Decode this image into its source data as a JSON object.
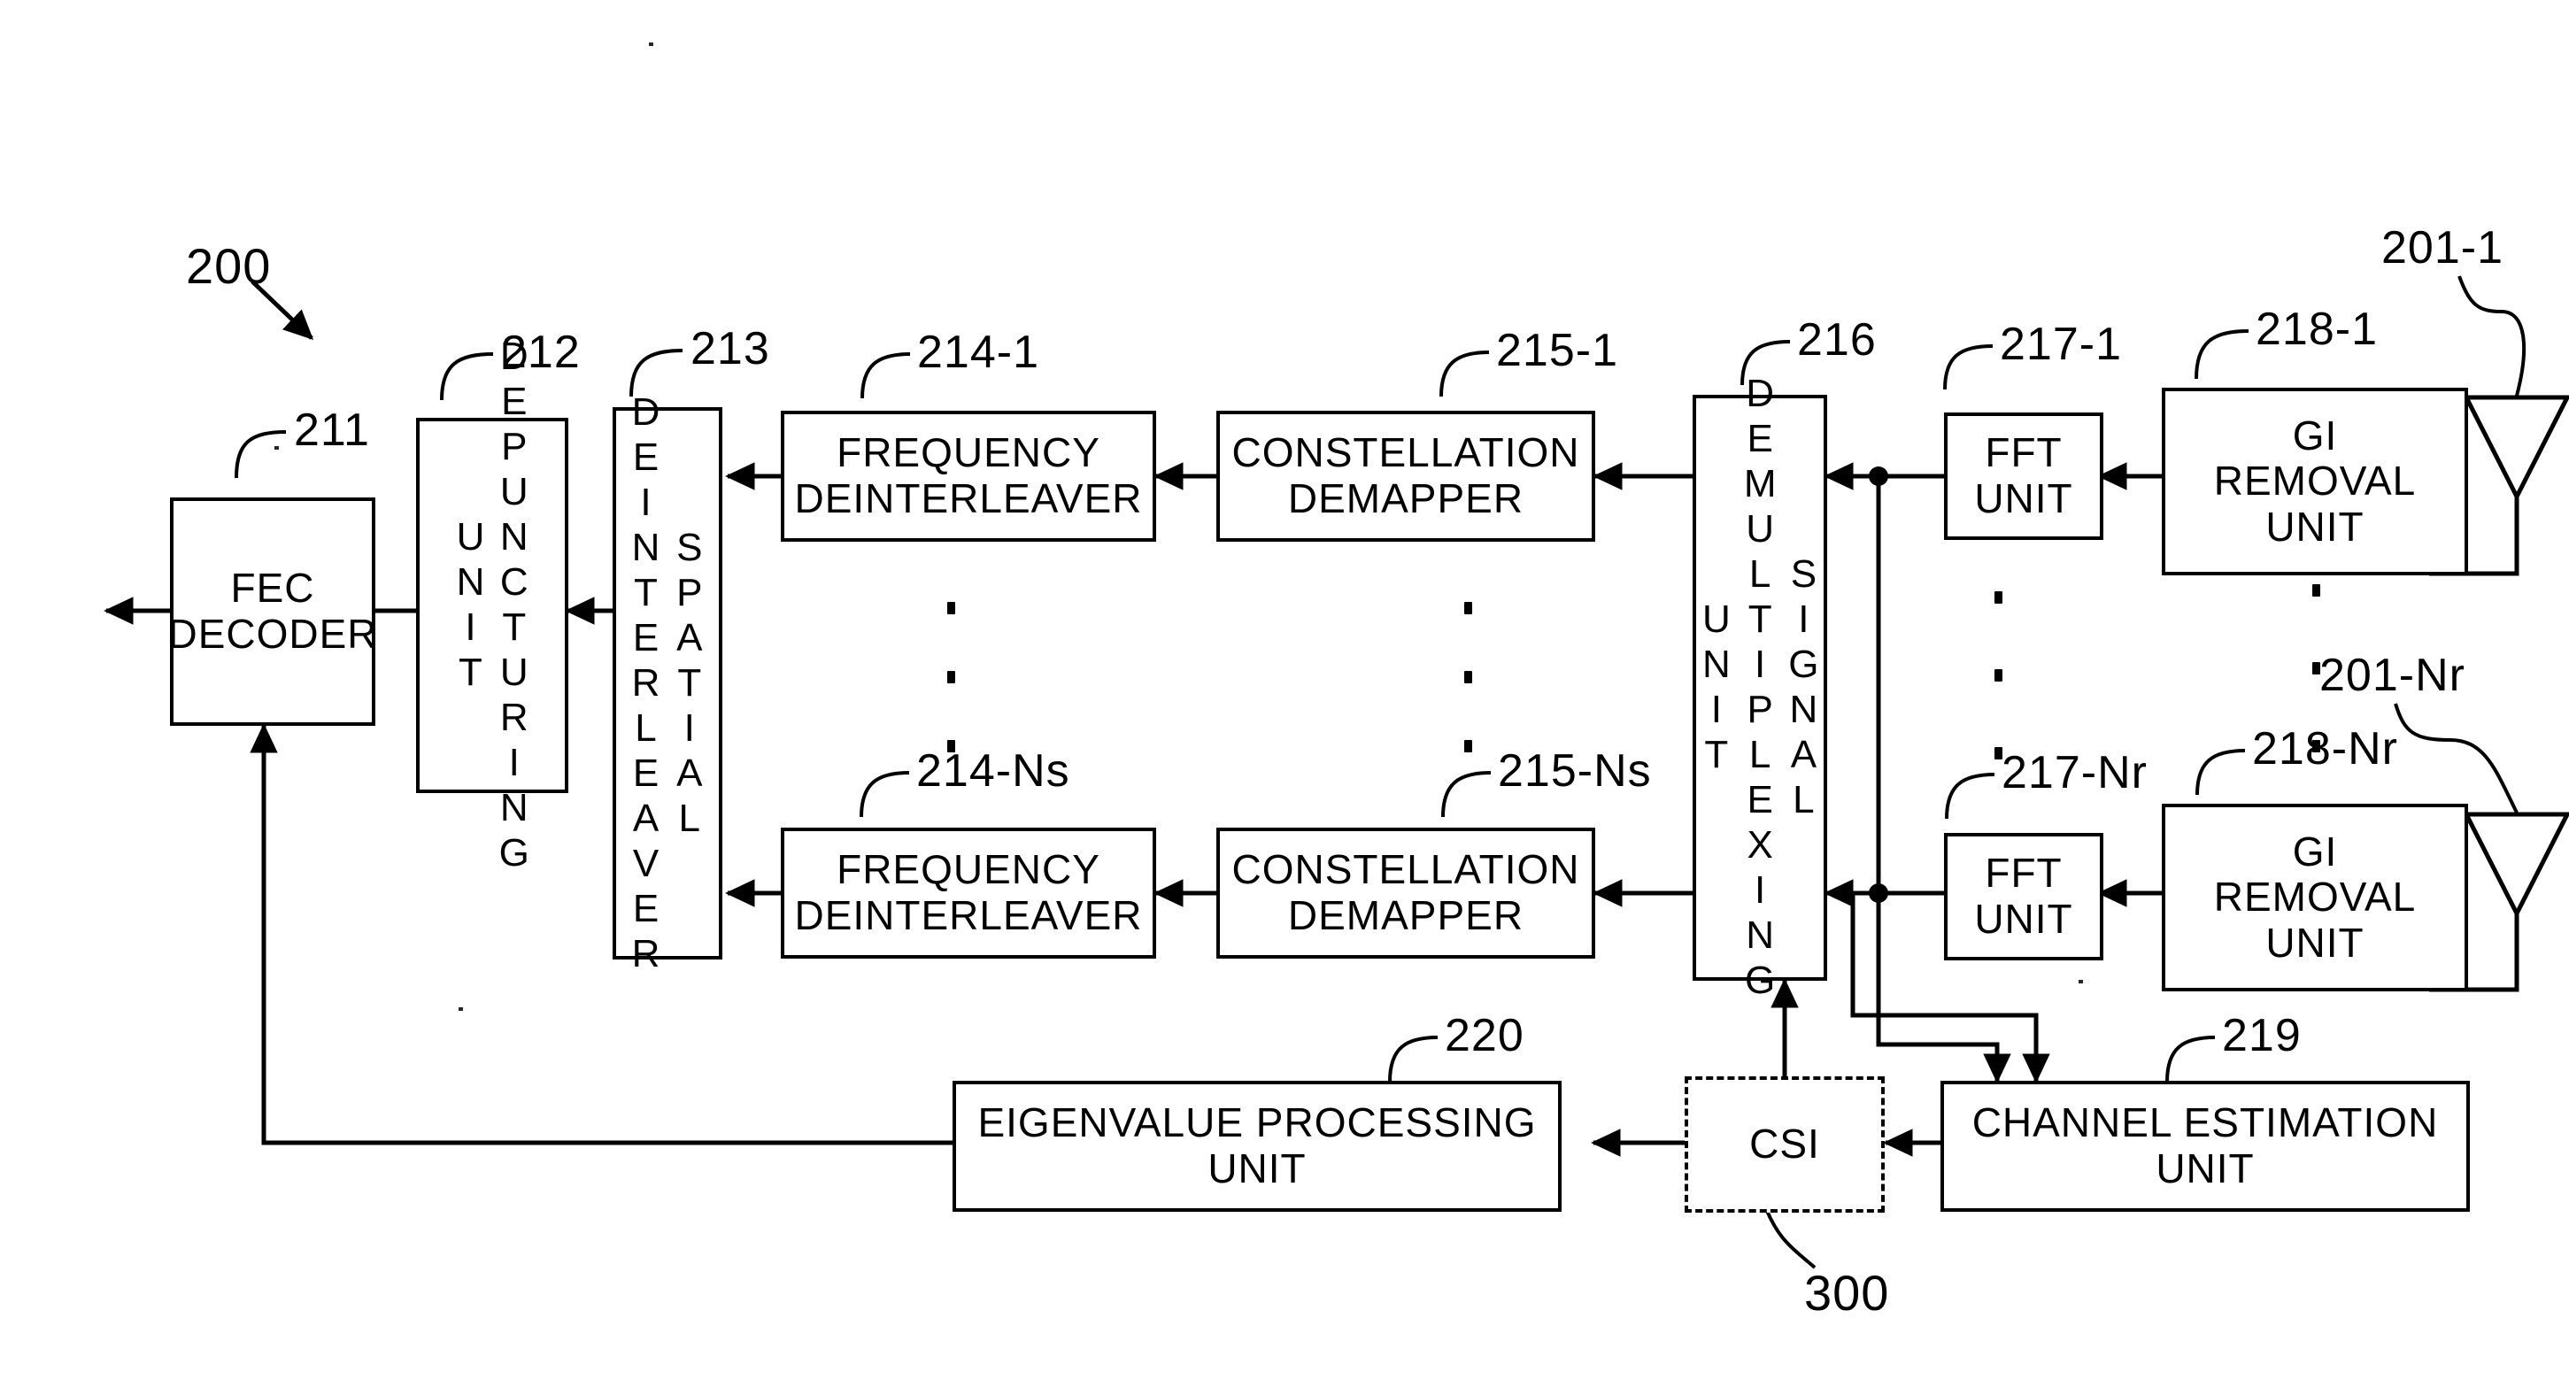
{
  "figure": {
    "kind": "patent-block-diagram",
    "title_ref": "200",
    "line_color": "#000000",
    "background": "#ffffff"
  },
  "blocks": {
    "fec_decoder": {
      "label": "FEC\nDECODER",
      "ref": "211"
    },
    "depuncturing": {
      "label": "DEPUNCTURING UNIT",
      "ref": "212"
    },
    "spatial_deint": {
      "label": "SPATIAL DEINTERLEAVER",
      "ref": "213"
    },
    "freq_deint_1": {
      "label": "FREQUENCY\nDEINTERLEAVER",
      "ref": "214-1"
    },
    "freq_deint_ns": {
      "label": "FREQUENCY\nDEINTERLEAVER",
      "ref": "214-Ns"
    },
    "demapper_1": {
      "label": "CONSTELLATION\nDEMAPPER",
      "ref": "215-1"
    },
    "demapper_ns": {
      "label": "CONSTELLATION\nDEMAPPER",
      "ref": "215-Ns"
    },
    "signal_demux": {
      "label": "SIGNAL DEMULTIPLEXING UNIT",
      "ref": "216"
    },
    "fft_1": {
      "label": "FFT\nUNIT",
      "ref": "217-1"
    },
    "fft_nr": {
      "label": "FFT\nUNIT",
      "ref": "217-Nr"
    },
    "gi_removal_1": {
      "label": "GI\nREMOVAL\nUNIT",
      "ref": "218-1"
    },
    "gi_removal_nr": {
      "label": "GI\nREMOVAL\nUNIT",
      "ref": "218-Nr"
    },
    "channel_estimation": {
      "label": "CHANNEL ESTIMATION\nUNIT",
      "ref": "219"
    },
    "eigenvalue": {
      "label": "EIGENVALUE PROCESSING\nUNIT",
      "ref": "220"
    },
    "csi": {
      "label": "CSI",
      "ref": "300"
    },
    "antenna_1": {
      "label": "",
      "ref": "201-1"
    },
    "antenna_nr": {
      "label": "",
      "ref": "201-Nr"
    }
  },
  "refs": {
    "system": "200",
    "fec_decoder": "211",
    "depuncturing": "212",
    "spatial_deint": "213",
    "freq_deint_1": "214-1",
    "freq_deint_ns": "214-Ns",
    "demapper_1": "215-1",
    "demapper_ns": "215-Ns",
    "signal_demux": "216",
    "fft_1": "217-1",
    "fft_nr": "217-Nr",
    "gi_removal_1": "218-1",
    "gi_removal_nr": "218-Nr",
    "channel_estimation": "219",
    "eigenvalue": "220",
    "antenna_1": "201-1",
    "antenna_nr": "201-Nr",
    "csi": "300"
  },
  "ellipsis": {
    "glyph": "·",
    "count": 3
  }
}
